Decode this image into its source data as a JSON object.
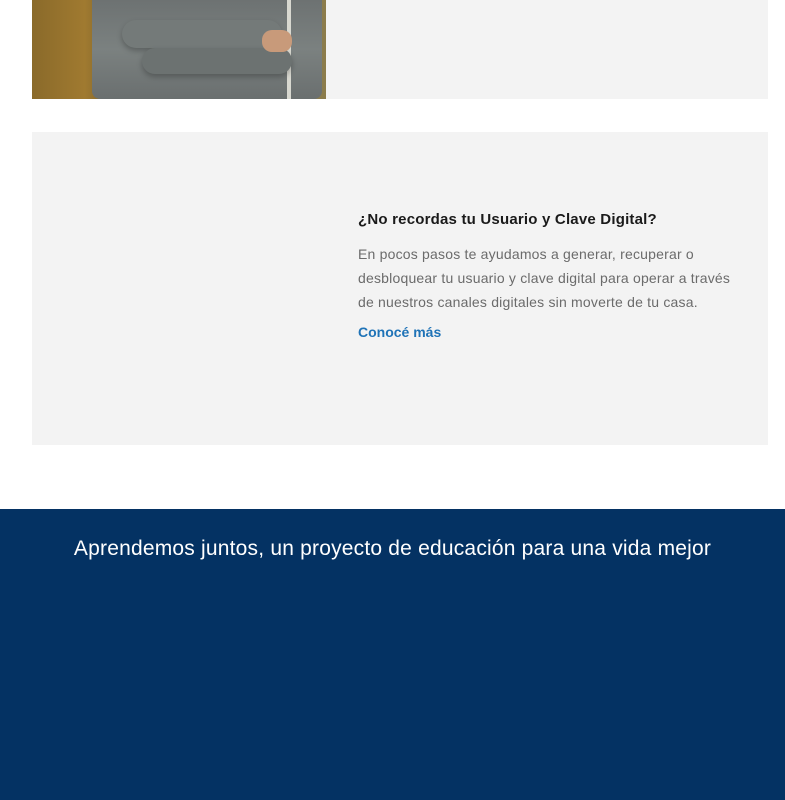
{
  "recover_card": {
    "title": "¿No recordas tu Usuario y Clave Digital?",
    "description": "En pocos pasos te ayudamos a generar, recuperar o desbloquear tu usuario y clave digital para operar a través de nuestros canales digitales sin moverte de tu casa.",
    "link_label": "Conocé más",
    "link_color": "#1f73b7"
  },
  "education_banner": {
    "title": "Aprendemos juntos, un proyecto de educación para una vida mejor",
    "background_color": "#043263"
  },
  "colors": {
    "card_background": "#f3f3f3",
    "title_text": "#1a1a1a",
    "body_text": "#6b6b6b"
  }
}
